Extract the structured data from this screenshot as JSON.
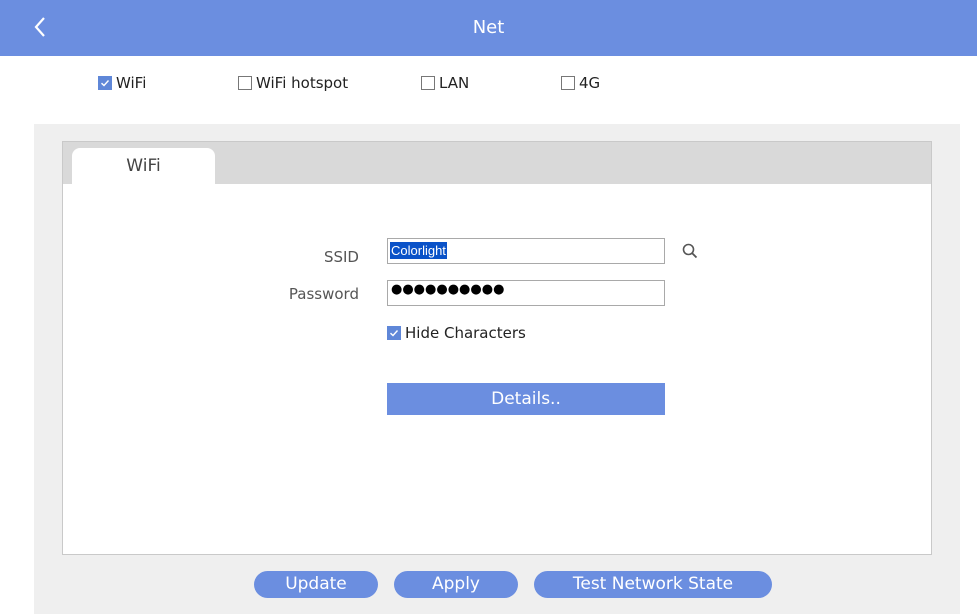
{
  "header": {
    "title": "Net"
  },
  "net_options": [
    {
      "label": "WiFi",
      "checked": true
    },
    {
      "label": "WiFi hotspot",
      "checked": false
    },
    {
      "label": "LAN",
      "checked": false
    },
    {
      "label": "4G",
      "checked": false
    }
  ],
  "tab": {
    "label": "WiFi"
  },
  "form": {
    "ssid_label": "SSID",
    "ssid_value": "Colorlight",
    "password_label": "Password",
    "password_value": "●●●●●●●●●●",
    "hide_characters_label": "Hide Characters",
    "hide_characters_checked": true,
    "details_label": "Details.."
  },
  "footer": {
    "update_label": "Update",
    "apply_label": "Apply",
    "test_label": "Test Network State"
  },
  "colors": {
    "accent": "#6b8ee0",
    "selection": "#0a52c8",
    "panel_bg": "#efefef"
  }
}
